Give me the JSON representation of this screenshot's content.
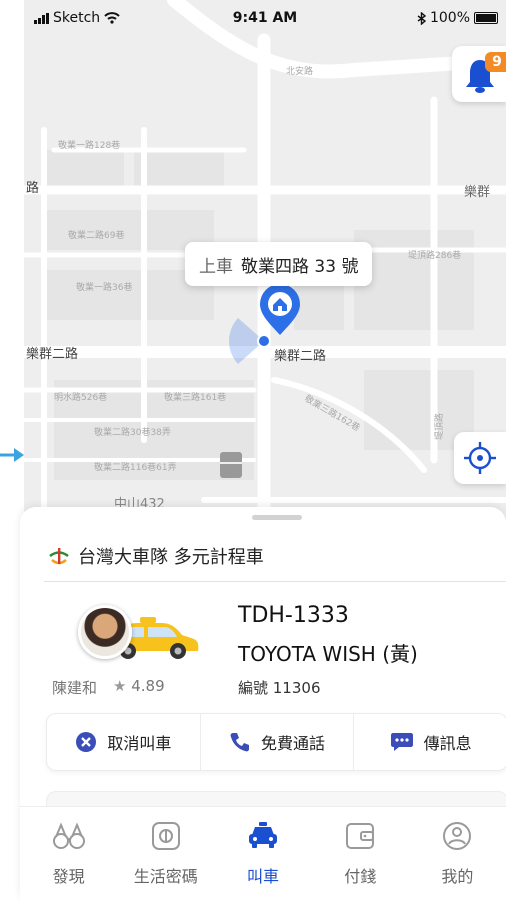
{
  "status_bar": {
    "carrier": "Sketch",
    "time": "9:41 AM",
    "battery": "100%"
  },
  "map": {
    "street_labels": [
      "北安路",
      "樂群",
      "敬業一路128巷",
      "路",
      "敬業二路69巷",
      "敬業一路36巷",
      "樂群二路",
      "樂群二路",
      "堤頂路286巷",
      "明水路526巷",
      "敬業三路161巷",
      "敬業三路162巷",
      "敬業二路30巷38弄",
      "敬業二路116巷61弄",
      "中山432",
      "堤頂路"
    ],
    "pickup": {
      "label": "上車",
      "address": "敬業四路 33 號"
    }
  },
  "notifications": {
    "count": "9"
  },
  "colors": {
    "accent": "#1b4fd1",
    "badge": "#f28a25",
    "pin": "#2c6fe6"
  },
  "sheet": {
    "fleet_name": "台灣大車隊 多元計程車",
    "driver": {
      "name": "陳建和",
      "rating_icon": "★",
      "rating": "4.89"
    },
    "vehicle": {
      "plate": "TDH-1333",
      "model": "TOYOTA WISH (黃)",
      "number": "編號 11306"
    },
    "actions": [
      {
        "icon": "cancel-icon",
        "label": "取消叫車"
      },
      {
        "icon": "phone-icon",
        "label": "免費通話"
      },
      {
        "icon": "message-icon",
        "label": "傳訊息"
      }
    ]
  },
  "tabs": [
    {
      "icon": "binoculars-icon",
      "label": "發現",
      "active": false
    },
    {
      "icon": "code-icon",
      "label": "生活密碼",
      "active": false
    },
    {
      "icon": "taxi-icon",
      "label": "叫車",
      "active": true
    },
    {
      "icon": "wallet-icon",
      "label": "付錢",
      "active": false
    },
    {
      "icon": "profile-icon",
      "label": "我的",
      "active": false
    }
  ]
}
